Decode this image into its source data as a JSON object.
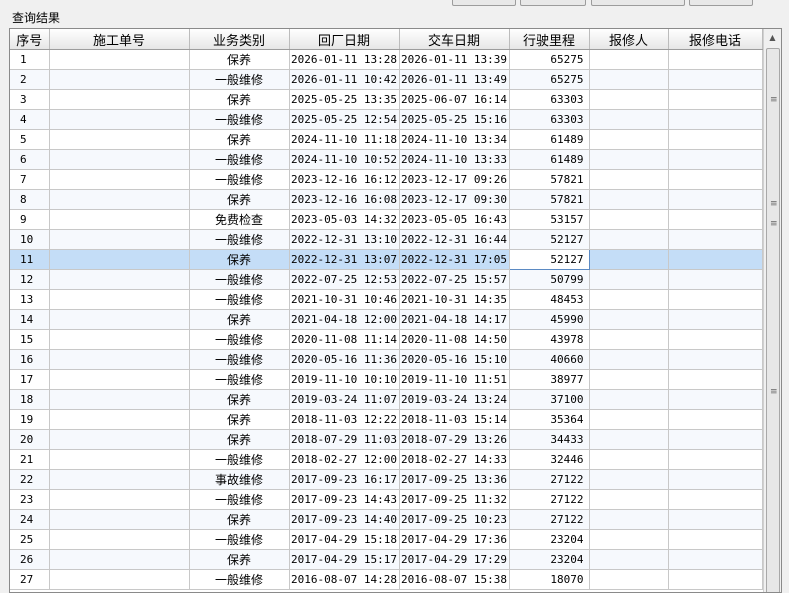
{
  "group_title": "查询结果",
  "columns": [
    "序号",
    "施工单号",
    "业务类别",
    "回厂日期",
    "交车日期",
    "行驶里程",
    "报修人",
    "报修电话"
  ],
  "selected_row": 10,
  "rows": [
    {
      "no": "1",
      "order": "",
      "category": "保养",
      "in_date": "2026-01-11 13:28",
      "out_date": "2026-01-11 13:39",
      "mileage": "65275",
      "reporter": "",
      "phone": ""
    },
    {
      "no": "2",
      "order": "",
      "category": "一般维修",
      "in_date": "2026-01-11 10:42",
      "out_date": "2026-01-11 13:49",
      "mileage": "65275",
      "reporter": "",
      "phone": ""
    },
    {
      "no": "3",
      "order": "",
      "category": "保养",
      "in_date": "2025-05-25 13:35",
      "out_date": "2025-06-07 16:14",
      "mileage": "63303",
      "reporter": "",
      "phone": ""
    },
    {
      "no": "4",
      "order": "",
      "category": "一般维修",
      "in_date": "2025-05-25 12:54",
      "out_date": "2025-05-25 15:16",
      "mileage": "63303",
      "reporter": "",
      "phone": ""
    },
    {
      "no": "5",
      "order": "",
      "category": "保养",
      "in_date": "2024-11-10 11:18",
      "out_date": "2024-11-10 13:34",
      "mileage": "61489",
      "reporter": "",
      "phone": ""
    },
    {
      "no": "6",
      "order": "",
      "category": "一般维修",
      "in_date": "2024-11-10 10:52",
      "out_date": "2024-11-10 13:33",
      "mileage": "61489",
      "reporter": "",
      "phone": ""
    },
    {
      "no": "7",
      "order": "",
      "category": "一般维修",
      "in_date": "2023-12-16 16:12",
      "out_date": "2023-12-17 09:26",
      "mileage": "57821",
      "reporter": "",
      "phone": ""
    },
    {
      "no": "8",
      "order": "",
      "category": "保养",
      "in_date": "2023-12-16 16:08",
      "out_date": "2023-12-17 09:30",
      "mileage": "57821",
      "reporter": "",
      "phone": ""
    },
    {
      "no": "9",
      "order": "",
      "category": "免费检查",
      "in_date": "2023-05-03 14:32",
      "out_date": "2023-05-05 16:43",
      "mileage": "53157",
      "reporter": "",
      "phone": ""
    },
    {
      "no": "10",
      "order": "",
      "category": "一般维修",
      "in_date": "2022-12-31 13:10",
      "out_date": "2022-12-31 16:44",
      "mileage": "52127",
      "reporter": "",
      "phone": ""
    },
    {
      "no": "11",
      "order": "",
      "category": "保养",
      "in_date": "2022-12-31 13:07",
      "out_date": "2022-12-31 17:05",
      "mileage": "52127",
      "reporter": "",
      "phone": ""
    },
    {
      "no": "12",
      "order": "",
      "category": "一般维修",
      "in_date": "2022-07-25 12:53",
      "out_date": "2022-07-25 15:57",
      "mileage": "50799",
      "reporter": "",
      "phone": ""
    },
    {
      "no": "13",
      "order": "",
      "category": "一般维修",
      "in_date": "2021-10-31 10:46",
      "out_date": "2021-10-31 14:35",
      "mileage": "48453",
      "reporter": "",
      "phone": ""
    },
    {
      "no": "14",
      "order": "",
      "category": "保养",
      "in_date": "2021-04-18 12:00",
      "out_date": "2021-04-18 14:17",
      "mileage": "45990",
      "reporter": "",
      "phone": ""
    },
    {
      "no": "15",
      "order": "",
      "category": "一般维修",
      "in_date": "2020-11-08 11:14",
      "out_date": "2020-11-08 14:50",
      "mileage": "43978",
      "reporter": "",
      "phone": ""
    },
    {
      "no": "16",
      "order": "",
      "category": "一般维修",
      "in_date": "2020-05-16 11:36",
      "out_date": "2020-05-16 15:10",
      "mileage": "40660",
      "reporter": "",
      "phone": ""
    },
    {
      "no": "17",
      "order": "",
      "category": "一般维修",
      "in_date": "2019-11-10 10:10",
      "out_date": "2019-11-10 11:51",
      "mileage": "38977",
      "reporter": "",
      "phone": ""
    },
    {
      "no": "18",
      "order": "",
      "category": "保养",
      "in_date": "2019-03-24 11:07",
      "out_date": "2019-03-24 13:24",
      "mileage": "37100",
      "reporter": "",
      "phone": ""
    },
    {
      "no": "19",
      "order": "",
      "category": "保养",
      "in_date": "2018-11-03 12:22",
      "out_date": "2018-11-03 15:14",
      "mileage": "35364",
      "reporter": "",
      "phone": ""
    },
    {
      "no": "20",
      "order": "",
      "category": "保养",
      "in_date": "2018-07-29 11:03",
      "out_date": "2018-07-29 13:26",
      "mileage": "34433",
      "reporter": "",
      "phone": ""
    },
    {
      "no": "21",
      "order": "",
      "category": "一般维修",
      "in_date": "2018-02-27 12:00",
      "out_date": "2018-02-27 14:33",
      "mileage": "32446",
      "reporter": "",
      "phone": ""
    },
    {
      "no": "22",
      "order": "",
      "category": "事故维修",
      "in_date": "2017-09-23 16:17",
      "out_date": "2017-09-25 13:36",
      "mileage": "27122",
      "reporter": "",
      "phone": ""
    },
    {
      "no": "23",
      "order": "",
      "category": "一般维修",
      "in_date": "2017-09-23 14:43",
      "out_date": "2017-09-25 11:32",
      "mileage": "27122",
      "reporter": "",
      "phone": ""
    },
    {
      "no": "24",
      "order": "",
      "category": "保养",
      "in_date": "2017-09-23 14:40",
      "out_date": "2017-09-25 10:23",
      "mileage": "27122",
      "reporter": "",
      "phone": ""
    },
    {
      "no": "25",
      "order": "",
      "category": "一般维修",
      "in_date": "2017-04-29 15:18",
      "out_date": "2017-04-29 17:36",
      "mileage": "23204",
      "reporter": "",
      "phone": ""
    },
    {
      "no": "26",
      "order": "",
      "category": "保养",
      "in_date": "2017-04-29 15:17",
      "out_date": "2017-04-29 17:29",
      "mileage": "23204",
      "reporter": "",
      "phone": ""
    },
    {
      "no": "27",
      "order": "",
      "category": "一般维修",
      "in_date": "2016-08-07 14:28",
      "out_date": "2016-08-07 15:38",
      "mileage": "18070",
      "reporter": "",
      "phone": ""
    }
  ]
}
